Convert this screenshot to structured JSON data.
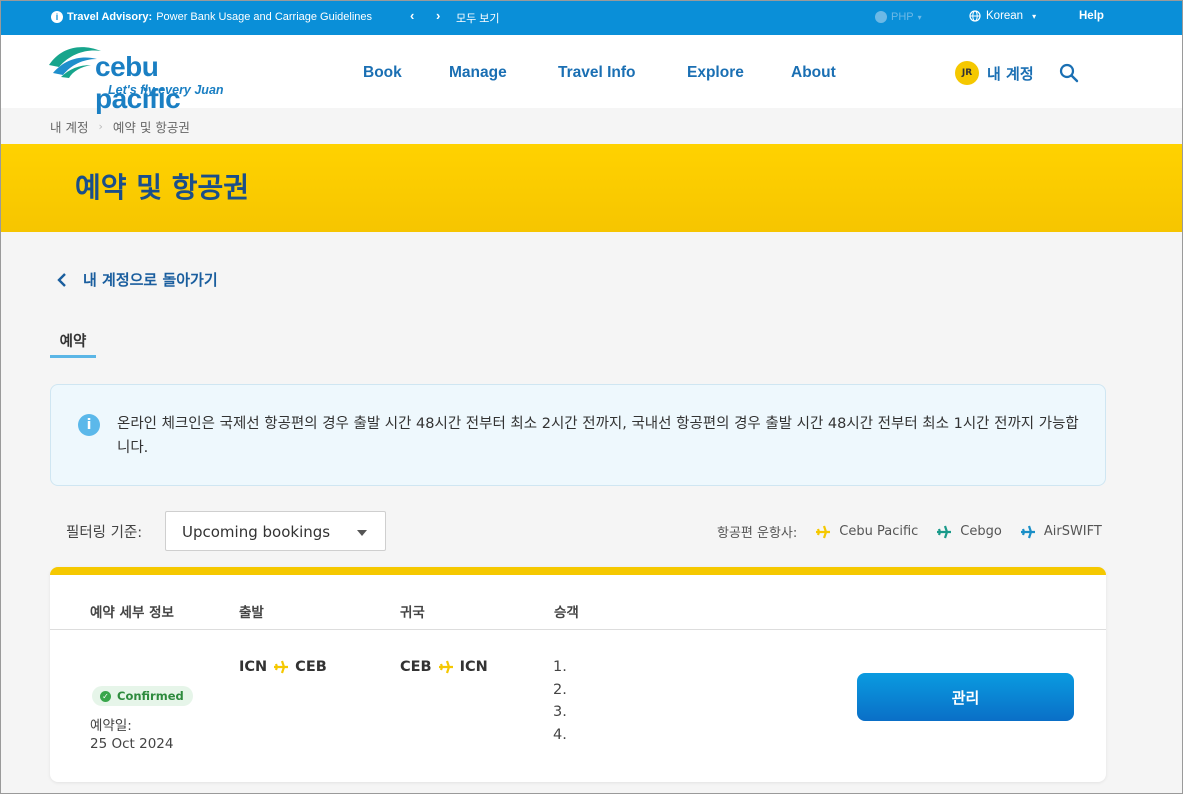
{
  "topbar": {
    "advisory_label": "Travel Advisory:",
    "advisory_text": "Power Bank Usage and Carriage Guidelines",
    "see_all": "모두 보기",
    "currency": "PHP",
    "language": "Korean",
    "help": "Help"
  },
  "header": {
    "brand": "cebu pacific",
    "tagline": "Let's fly every Juan",
    "nav": [
      "Book",
      "Manage",
      "Travel Info",
      "Explore",
      "About"
    ],
    "account_initials": "JR",
    "account_label": "내 계정"
  },
  "breadcrumb": [
    "내 계정",
    "예약 및 항공권"
  ],
  "page_title": "예약 및 항공권",
  "back_link": "내 계정으로 돌아가기",
  "tab_label": "예약",
  "notice": "온라인 체크인은 국제선 항공편의 경우 출발 시간 48시간 전부터 최소 2시간 전까지, 국내선 항공편의 경우 출발 시간 48시간 전부터 최소 1시간 전까지 가능합니다.",
  "filter": {
    "label": "필터링 기준:",
    "value": "Upcoming bookings"
  },
  "carriers": {
    "label": "항공편 운항사:",
    "items": [
      {
        "name": "Cebu Pacific",
        "color": "#f5c800"
      },
      {
        "name": "Cebgo",
        "color": "#1a9a8a"
      },
      {
        "name": "AirSWIFT",
        "color": "#1a8fc7"
      }
    ]
  },
  "table": {
    "headers": [
      "예약 세부 정보",
      "출발",
      "귀국",
      "승객"
    ],
    "booking": {
      "status": "Confirmed",
      "booking_date_label": "예약일:",
      "booking_date": "25 Oct 2024",
      "departure": {
        "from": "ICN",
        "to": "CEB"
      },
      "return": {
        "from": "CEB",
        "to": "ICN"
      },
      "passengers": [
        "1.",
        "2.",
        "3.",
        "4."
      ],
      "action": "관리"
    }
  },
  "colors": {
    "accent_blue": "#0a8fd8",
    "banner_yellow": "#ffd200",
    "title_blue": "#1a4e8a"
  }
}
